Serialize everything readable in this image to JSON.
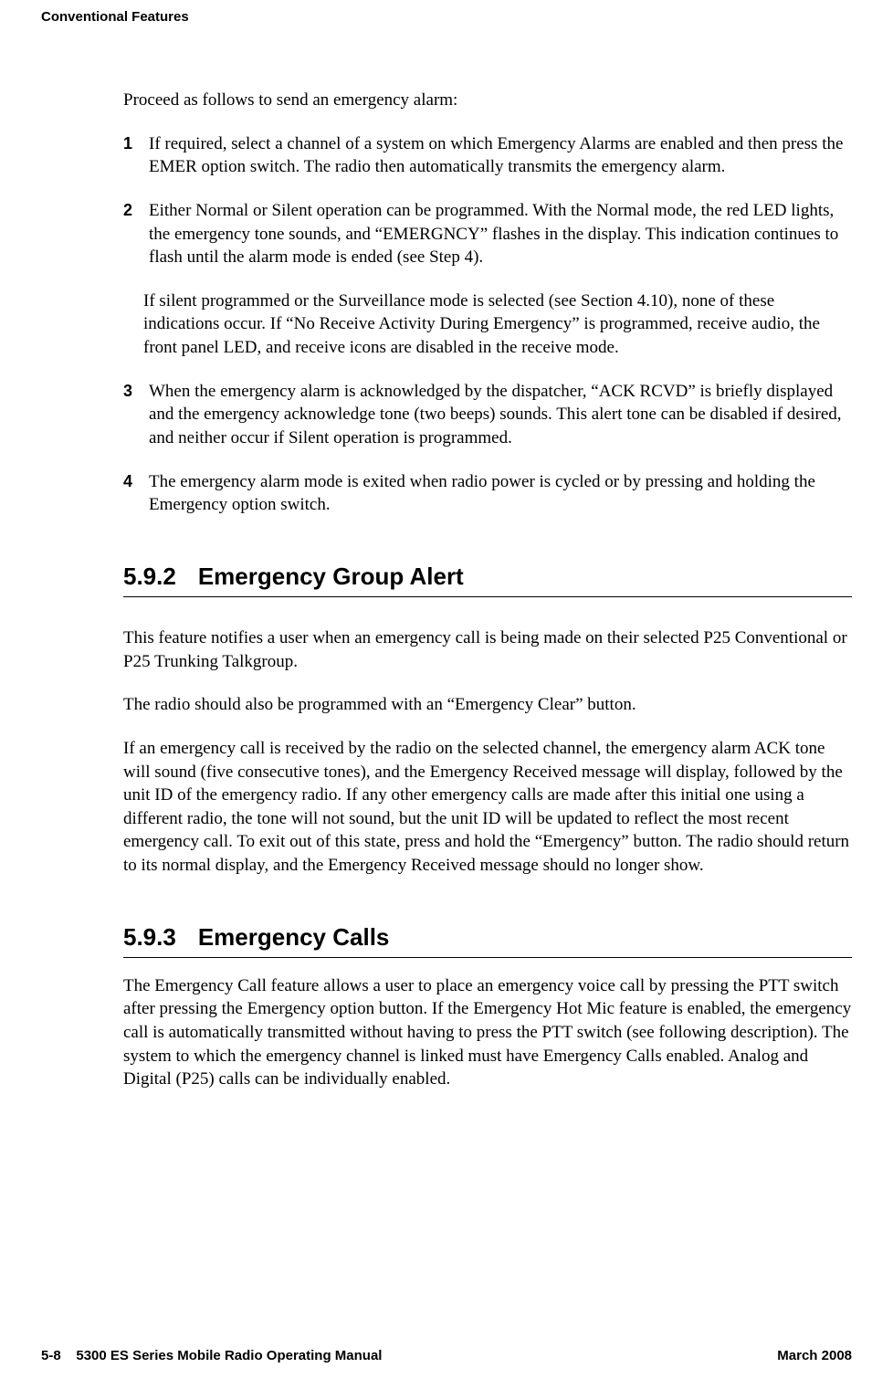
{
  "header": {
    "running_title": "Conventional Features"
  },
  "intro": "Proceed as follows to send an emergency alarm:",
  "steps": {
    "n1": "1",
    "s1": "If required, select a channel of a system on which Emergency Alarms are enabled and then press the EMER option switch. The radio then automatically transmits the emergency alarm.",
    "n2": "2",
    "s2a": "Either Normal or Silent operation can be programmed. With the Normal mode, the red LED lights, the emergency tone sounds, and “EMERGNCY” flashes in the display. This indication continues to flash until the alarm mode is ended (see Step 4).",
    "s2b": "If silent programmed or the Surveillance mode is selected (see Section 4.10), none of these indications occur. If “No Receive Activity During Emergency” is programmed, receive audio, the front panel LED, and receive icons are disabled in the receive mode.",
    "n3": "3",
    "s3": "When the emergency alarm is acknowledged by the dispatcher, “ACK RCVD” is briefly displayed and the emergency acknowledge tone (two beeps) sounds. This alert tone can be disabled if desired, and neither occur if Silent operation is programmed.",
    "n4": "4",
    "s4": "The emergency alarm mode is exited when radio power is cycled or by pressing and holding the Emergency option switch."
  },
  "section592": {
    "num": "5.9.2",
    "title": "Emergency Group Alert",
    "p1": "This feature notifies a user when an emergency call is being made on their selected P25 Conventional or P25 Trunking Talkgroup.",
    "p2": "The radio should also be programmed with an “Emergency Clear” button.",
    "p3": "If an emergency call is received by the radio on the selected channel, the emergency alarm ACK tone will sound (five consecutive tones), and the Emergency Received message will display, followed by the unit ID of the emergency radio. If any other emergency calls are made after this initial one using a different radio, the tone will not sound, but the unit ID will be updated to reflect the most recent emergency call. To exit out of this state, press and hold the “Emergency” button. The radio should return to its normal display, and the Emergency Received message should no longer show."
  },
  "section593": {
    "num": "5.9.3",
    "title": "Emergency Calls",
    "p1": "The Emergency Call feature allows a user to place an emergency voice call by pressing the PTT switch after pressing the Emergency option button. If the Emergency Hot Mic feature is enabled, the emergency call is automatically transmitted without having to press the PTT switch (see following description). The system to which the emergency channel is linked must have Emergency Calls enabled. Analog and Digital (P25) calls can be individually enabled."
  },
  "footer": {
    "left_page": "5-8",
    "left_title": "5300 ES Series Mobile Radio Operating Manual",
    "right": "March 2008"
  }
}
